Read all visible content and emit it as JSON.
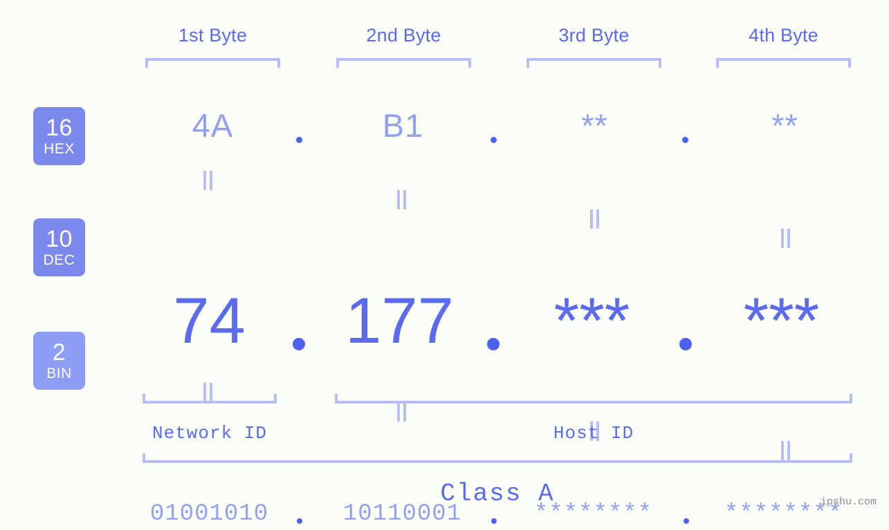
{
  "page": {
    "background_color": "#fbfdf8",
    "accent_color": "#5a6bf0",
    "accent_light_color": "#93a0f2",
    "bracket_color": "#b6bdf7",
    "watermark": "ipshu.com"
  },
  "byte_headers": [
    {
      "label": "1st Byte"
    },
    {
      "label": "2nd Byte"
    },
    {
      "label": "3rd Byte"
    },
    {
      "label": "4th Byte"
    }
  ],
  "rows": [
    {
      "badge_number": "16",
      "badge_name": "HEX",
      "badge_color": "#7b88ec",
      "values": [
        "4A",
        "B1",
        "**",
        "**"
      ],
      "separator": "."
    },
    {
      "badge_number": "10",
      "badge_name": "DEC",
      "badge_color": "#7b88ec",
      "values": [
        "74",
        "177",
        "***",
        "***"
      ],
      "separator": "."
    },
    {
      "badge_number": "2",
      "badge_name": "BIN",
      "badge_color": "#8d9cf5",
      "values": [
        "01001010",
        "10110001",
        "********",
        "********"
      ],
      "separator": "."
    }
  ],
  "equals_marks": {
    "glyph": "=",
    "count_per_gap": 4,
    "gaps": 2
  },
  "id_sections": [
    {
      "label": "Network ID"
    },
    {
      "label": "Host ID"
    }
  ],
  "class_section": {
    "label": "Class A"
  }
}
